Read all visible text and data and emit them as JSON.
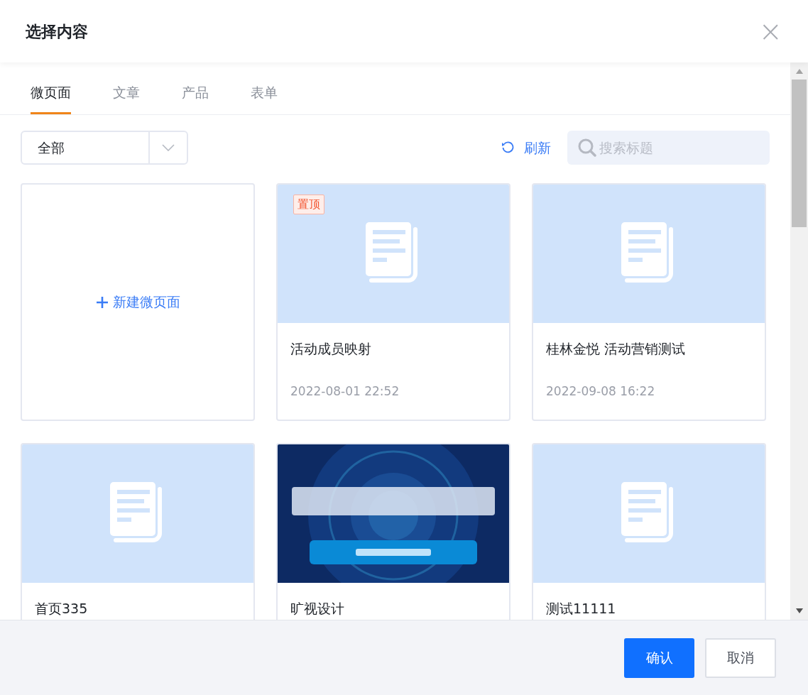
{
  "dialog": {
    "title": "选择内容",
    "close": "×"
  },
  "tabs": [
    {
      "label": "微页面",
      "selected": true
    },
    {
      "label": "文章",
      "selected": false
    },
    {
      "label": "产品",
      "selected": false
    },
    {
      "label": "表单",
      "selected": false
    }
  ],
  "filter": {
    "value": "全部"
  },
  "refresh": {
    "label": "刷新"
  },
  "search": {
    "placeholder": "搜索标题"
  },
  "cards": [
    {
      "kind": "new",
      "label": "新建微页面"
    },
    {
      "kind": "page",
      "badge": "置顶",
      "title": "活动成员映射",
      "date": "2022-08-01 22:52"
    },
    {
      "kind": "page",
      "title": "桂林金悦 活动营销测试",
      "date": "2022-09-08 16:22"
    },
    {
      "kind": "page",
      "title": "首页335"
    },
    {
      "kind": "picture_page",
      "title": "旷视设计"
    },
    {
      "kind": "page",
      "title": "测试11111"
    }
  ],
  "footer": {
    "confirm": "确认",
    "cancel": "取消"
  }
}
